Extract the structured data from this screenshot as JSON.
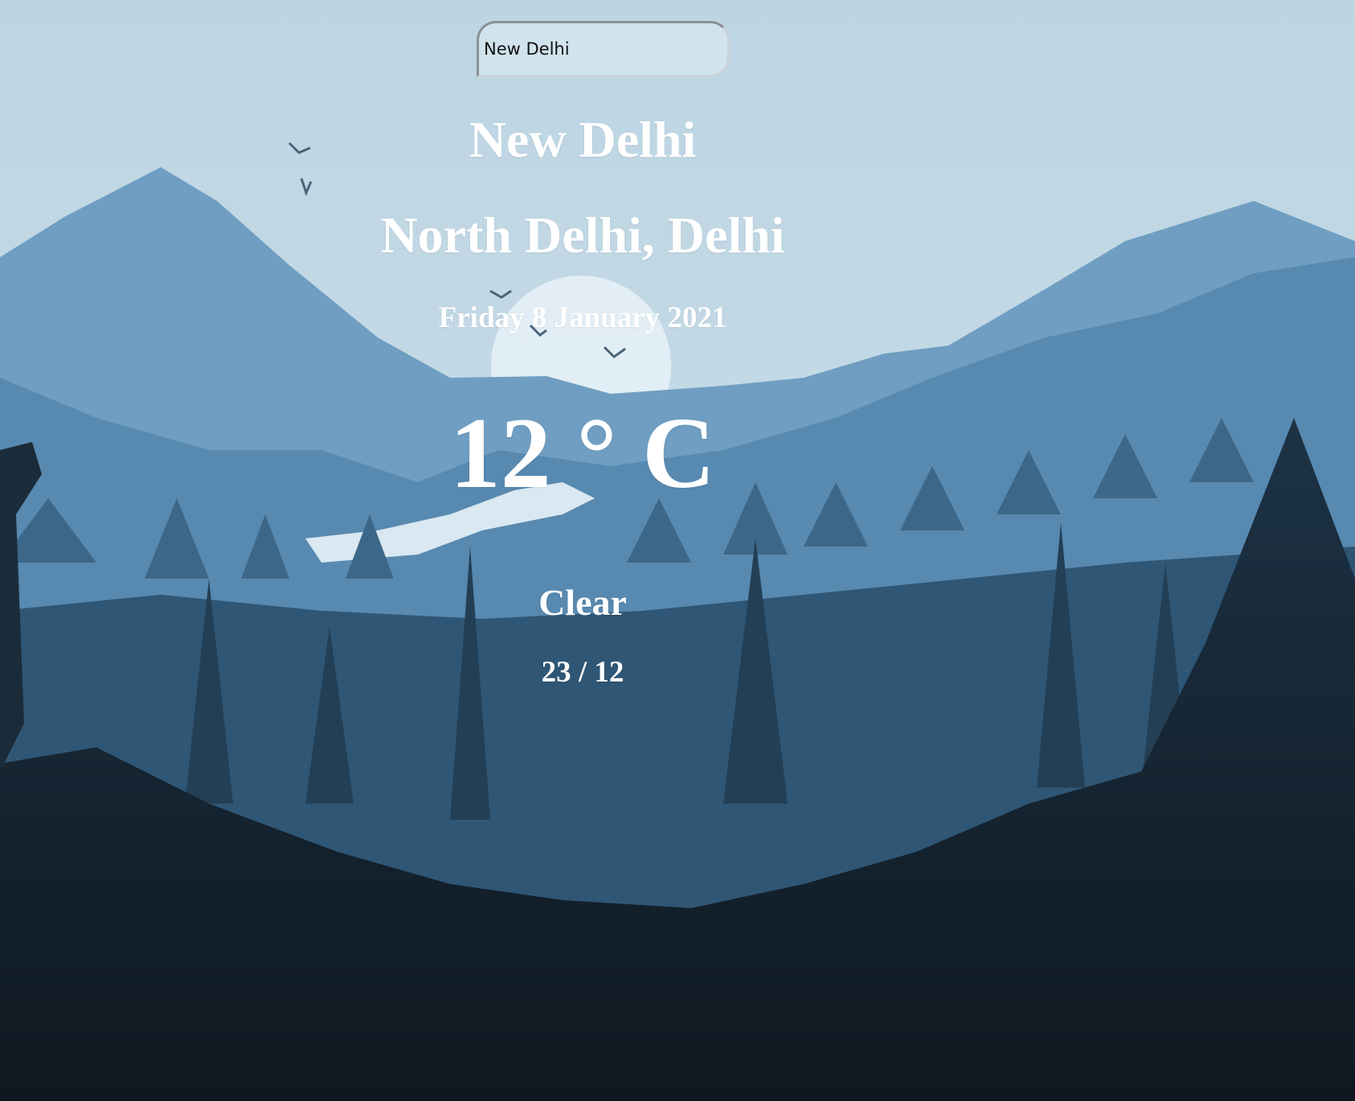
{
  "search": {
    "value": "New Delhi",
    "placeholder": ""
  },
  "weather": {
    "city": "New Delhi",
    "region": "North Delhi, Delhi",
    "date": "Friday 8 January 2021",
    "temperature": "12 ° C",
    "condition": "Clear",
    "high_low": "23 / 12"
  },
  "background": {
    "description_icon": "mountain-forest-landscape",
    "sky_color": "#bdd5e3",
    "far_mountain_color": "#6f9ec2",
    "mid_mountain_color": "#4d7fa6",
    "forest_color": "#2f5675",
    "foreground_color": "#121e28"
  }
}
